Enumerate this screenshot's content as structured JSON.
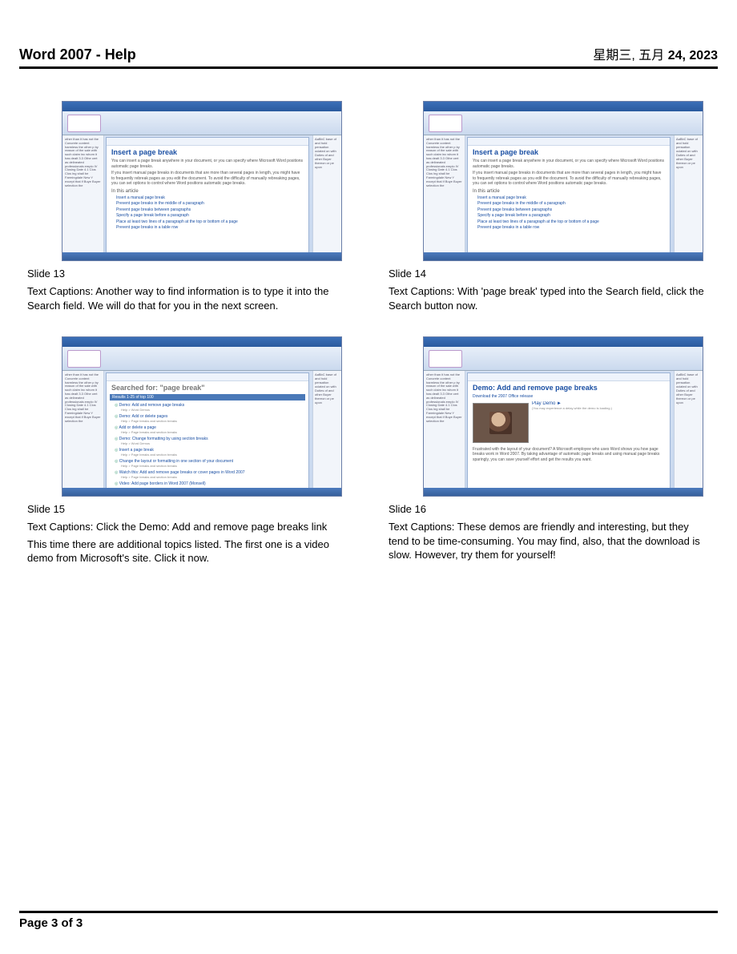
{
  "header": {
    "title": "Word 2007 - Help",
    "date_prefix": "星期三, 五月 ",
    "date_bold": "24, 2023"
  },
  "footer": {
    "page_label": "Page 3 of 3"
  },
  "help_pane_article": {
    "title": "Insert a page break",
    "intro1": "You can insert a page break anywhere in your document, or you can specify where Microsoft Word positions automatic page breaks.",
    "intro2": "If you insert manual page breaks in documents that are more than several pages in length, you might have to frequently rebreak pages as you edit the document. To avoid the difficulty of manually rebreaking pages, you can set options to control where Word positions automatic page breaks.",
    "section": "In this article",
    "links": [
      "Insert a manual page break",
      "Prevent page breaks in the middle of a paragraph",
      "Prevent page breaks between paragraphs",
      "Specify a page break before a paragraph",
      "Place at least two lines of a paragraph at the top or bottom of a page",
      "Prevent page breaks in a table row"
    ]
  },
  "search_results": {
    "query": "page break",
    "heading": "Searched for: \"page break\"",
    "items": [
      {
        "title": "Demo: Add and remove page breaks",
        "sub": "Help > Word Demos"
      },
      {
        "title": "Demo: Add or delete pages",
        "sub": "Help > Page breaks and section breaks"
      },
      {
        "title": "Add or delete a page",
        "sub": "Help > Page breaks and section breaks"
      },
      {
        "title": "Demo: Change formatting by using section breaks",
        "sub": "Help > Word Demos"
      },
      {
        "title": "Insert a page break",
        "sub": "Help > Page breaks and section breaks"
      },
      {
        "title": "Change the layout or formatting in one section of your document",
        "sub": "Help > Page breaks and section breaks"
      },
      {
        "title": "Watch this: Add and remove page breaks or cover pages in Word 2007",
        "sub": "Help > Page breaks and section breaks"
      },
      {
        "title": "Video: Add page borders in Word 2007 (Monsell)",
        "sub": ""
      }
    ]
  },
  "demo_pane": {
    "title": "Demo: Add and remove page breaks",
    "download": "Download the 2007 Office release",
    "play": "Play Demo",
    "note": "(You may experience a delay while the demo is loading.)",
    "desc": "Frustrated with the layout of your document? A Microsoft employee who uses Word shows you how page breaks work in Word 2007. By taking advantage of automatic page breaks and using manual page breaks sparingly, you can save yourself effort and get the results you want."
  },
  "slides": [
    {
      "label": "Slide 13",
      "caption": "Text Captions: Another way to find information is to type it into the Search field.  We will do that for you in the next screen.",
      "thumb_kind": "article"
    },
    {
      "label": "Slide 14",
      "caption": "Text Captions: With 'page break' typed into the Search field, click the Search button now.",
      "thumb_kind": "article"
    },
    {
      "label": "Slide 15",
      "caption": "Text Captions: Click the Demo: Add and remove page breaks link",
      "caption2": "This time there are additional topics listed.  The first one is a video demo from Microsoft's site. Click it now.",
      "thumb_kind": "search"
    },
    {
      "label": "Slide 16",
      "caption": "Text Captions: These demos are friendly and interesting, but they tend to be time-consuming.  You may find, also, that the download is slow.  However, try them for yourself!",
      "thumb_kind": "demo"
    }
  ]
}
